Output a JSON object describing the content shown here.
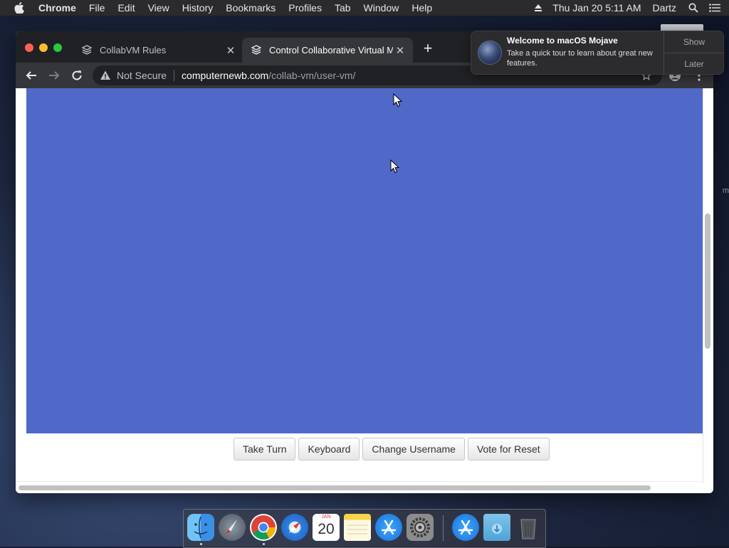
{
  "menubar": {
    "app_name": "Chrome",
    "menus": [
      "File",
      "Edit",
      "View",
      "History",
      "Bookmarks",
      "Profiles",
      "Tab",
      "Window",
      "Help"
    ],
    "clock": "Thu Jan 20  5:11 AM",
    "user": "Dartz"
  },
  "browser": {
    "tabs": [
      {
        "title": "CollabVM Rules",
        "active": false
      },
      {
        "title": "Control Collaborative Virtual M",
        "active": true
      }
    ],
    "new_tab_label": "+",
    "security_label": "Not Secure",
    "url_host": "computernewb.com",
    "url_path": "/collab-vm/user-vm/"
  },
  "page": {
    "vm_screen_color": "#5069c9",
    "buttons": {
      "take_turn": "Take Turn",
      "keyboard": "Keyboard",
      "change_username": "Change Username",
      "vote_reset": "Vote for Reset"
    }
  },
  "notification": {
    "title": "Welcome to macOS Mojave",
    "body": "Take a quick tour to learn about great new features.",
    "show_label": "Show",
    "later_label": "Later"
  },
  "desktop": {
    "fragment_text": "m"
  },
  "dock": {
    "items": [
      "finder-icon",
      "launchpad-icon",
      "chrome-icon",
      "safari-icon",
      "calendar-icon",
      "notes-icon",
      "app-store-icon",
      "system-preferences-icon",
      "app-store-download-icon",
      "downloads-folder-icon",
      "trash-icon"
    ],
    "calendar_month": "JAN",
    "calendar_day": "20"
  }
}
